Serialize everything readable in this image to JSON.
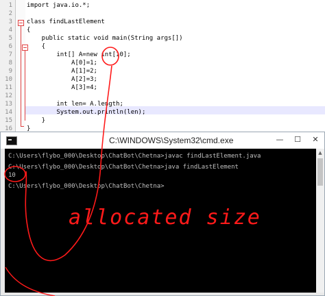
{
  "editor": {
    "lines": [
      {
        "n": "1",
        "text": "import java.io.*;"
      },
      {
        "n": "2",
        "text": ""
      },
      {
        "n": "3",
        "text": "class findLastElement"
      },
      {
        "n": "4",
        "text": "{"
      },
      {
        "n": "5",
        "text": "    public static void main(String args[])"
      },
      {
        "n": "6",
        "text": "    {"
      },
      {
        "n": "7",
        "text": "        int[] A=new int[10];"
      },
      {
        "n": "8",
        "text": "            A[0]=1;"
      },
      {
        "n": "9",
        "text": "            A[1]=2;"
      },
      {
        "n": "10",
        "text": "            A[2]=3;"
      },
      {
        "n": "11",
        "text": "            A[3]=4;"
      },
      {
        "n": "12",
        "text": ""
      },
      {
        "n": "13",
        "text": "        int len= A.length;"
      },
      {
        "n": "14",
        "text": "        System.out.println(len);"
      },
      {
        "n": "15",
        "text": "    }"
      },
      {
        "n": "16",
        "text": "}"
      }
    ]
  },
  "cmd": {
    "title": "C:\\WINDOWS\\System32\\cmd.exe",
    "buttons": {
      "minimize": "—",
      "maximize": "☐",
      "close": "✕"
    },
    "lines": [
      "C:\\Users\\flybo_000\\Desktop\\ChatBot\\Chetna>javac findLastElement.java",
      "C:\\Users\\flybo_000\\Desktop\\ChatBot\\Chetna>java findLastElement",
      "10",
      "",
      "C:\\Users\\flybo_000\\Desktop\\ChatBot\\Chetna>"
    ]
  },
  "annotation": {
    "text": "allocated size",
    "color": "#ff1a1a"
  }
}
